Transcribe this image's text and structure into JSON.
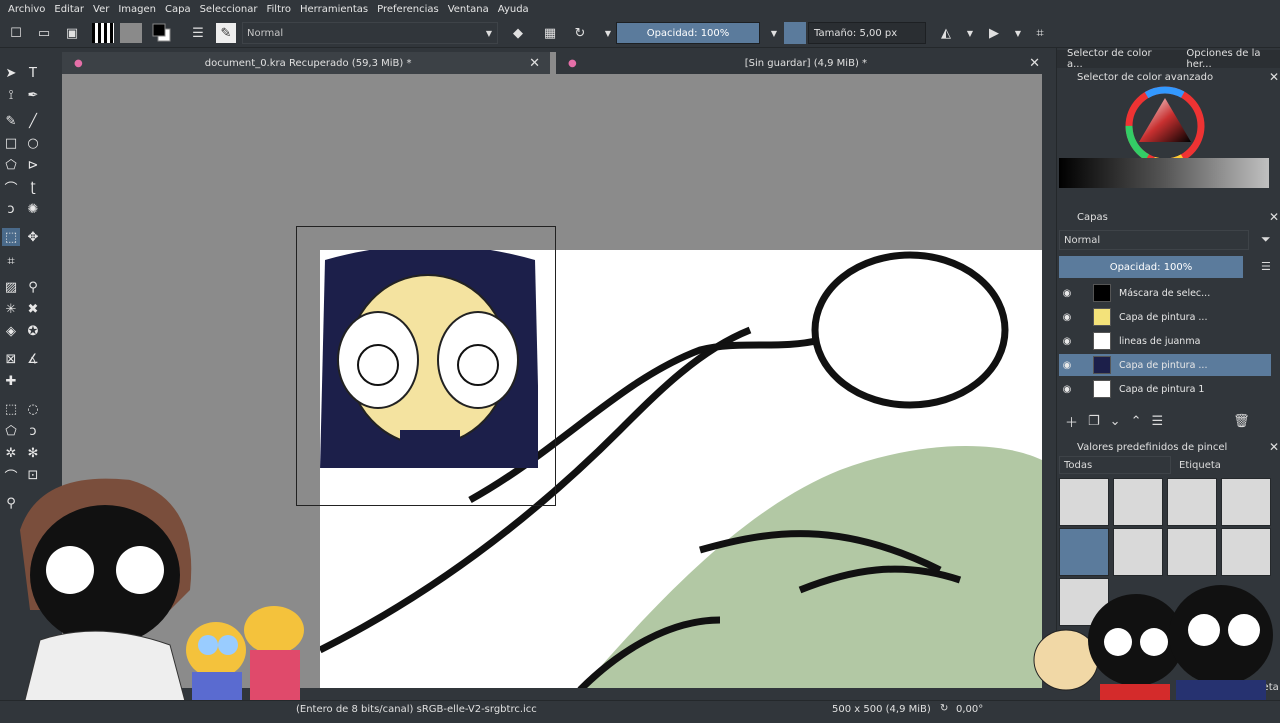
{
  "menu": [
    "Archivo",
    "Editar",
    "Ver",
    "Imagen",
    "Capa",
    "Seleccionar",
    "Filtro",
    "Herramientas",
    "Preferencias",
    "Ventana",
    "Ayuda"
  ],
  "toolbar": {
    "blend_mode": "Normal",
    "opacity_label": "Opacidad: 100%",
    "opacity_level": 1.0,
    "size_label": "Tamaño: 5,00 px"
  },
  "tabs": [
    {
      "title": "document_0.kra Recuperado (59,3 MiB) *"
    },
    {
      "title": "[Sin guardar]  (4,9 MiB) *"
    }
  ],
  "dock": {
    "tab1": "Selector de color a...",
    "tab2": "Opciones de la her...",
    "color_title": "Selector de color avanzado",
    "layers_title": "Capas",
    "layers_blend": "Normal",
    "layers_opacity": "Opacidad:  100%",
    "layers": [
      {
        "name": "Máscara de selec..."
      },
      {
        "name": "Capa de pintura ..."
      },
      {
        "name": "lineas de juanma"
      },
      {
        "name": "Capa de pintura ..."
      },
      {
        "name": "Capa de pintura 1"
      }
    ],
    "presets_title": "Valores predefinidos de pincel",
    "presets_filter": "Todas",
    "presets_tag": "Etiqueta"
  },
  "status": {
    "color_profile": "(Entero de 8 bits/canal)  sRGB-elle-V2-srgbtrc.icc",
    "size": "500 x 500 (4,9 MiB)",
    "rotation": "0,00°",
    "etiqueta": "etiqueta"
  },
  "colors": {
    "accent": "#5b7b9c",
    "bg": "#31363b",
    "canvas": "#8b8b8b",
    "green": "#b2c8a4"
  }
}
